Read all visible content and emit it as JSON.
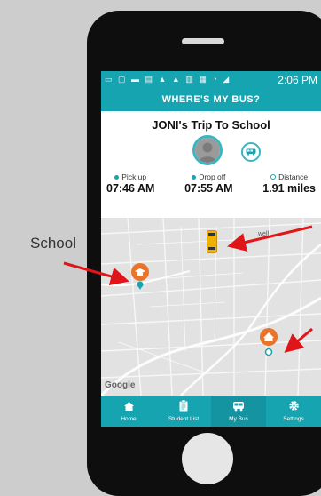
{
  "status_bar": {
    "time": "2:06 PM"
  },
  "app_bar": {
    "title": "WHERE'S MY BUS?"
  },
  "trip": {
    "title": "JONI's Trip To School"
  },
  "stats": [
    {
      "label": "Pick up",
      "value": "07:46 AM"
    },
    {
      "label": "Drop off",
      "value": "07:55 AM"
    },
    {
      "label": "Distance",
      "value": "1.91 miles"
    }
  ],
  "map": {
    "attribution": "Google",
    "place_label": "well"
  },
  "tabs": [
    {
      "label": "Home",
      "icon": "home-icon"
    },
    {
      "label": "Student List",
      "icon": "clipboard-icon"
    },
    {
      "label": "My Bus",
      "icon": "bus-icon",
      "active": true
    },
    {
      "label": "Settings",
      "icon": "gear-icon"
    }
  ],
  "annotation": {
    "label": "School"
  },
  "colors": {
    "accent": "#16a4b0",
    "marker": "#e8742a",
    "arrow": "#e0151a"
  }
}
